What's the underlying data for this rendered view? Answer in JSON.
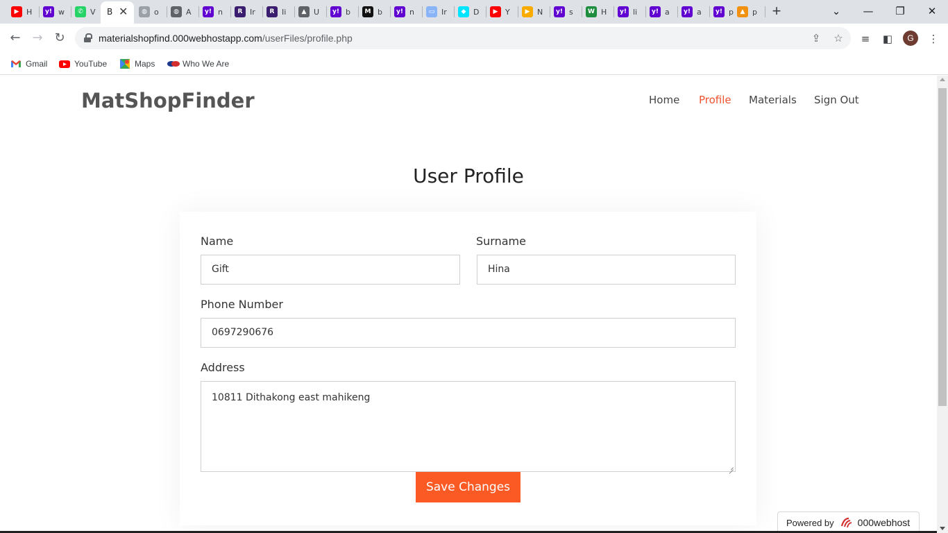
{
  "browser": {
    "tabs": [
      {
        "icon": "youtube-icon",
        "title": "H",
        "color": "#ff0000"
      },
      {
        "icon": "yahoo-icon",
        "title": "w",
        "color": "#6001d2"
      },
      {
        "icon": "whatsapp-icon",
        "title": "V",
        "color": "#25d366"
      },
      {
        "icon": "globe-icon",
        "title": "o",
        "color": "#9aa0a6"
      },
      {
        "icon": "globe-icon",
        "title": "A",
        "color": "#5f6368"
      },
      {
        "icon": "yahoo-icon",
        "title": "n",
        "color": "#6001d2"
      },
      {
        "icon": "r-icon",
        "title": "Ir",
        "color": "#3a1d6e"
      },
      {
        "icon": "r-icon",
        "title": "Ii",
        "color": "#3a1d6e"
      },
      {
        "icon": "cap-icon",
        "title": "U",
        "color": "#5f6368"
      },
      {
        "icon": "yahoo-icon",
        "title": "b",
        "color": "#6001d2"
      },
      {
        "icon": "m-icon",
        "title": "b",
        "color": "#111111"
      },
      {
        "icon": "yahoo-icon",
        "title": "n",
        "color": "#6001d2"
      },
      {
        "icon": "frame-icon",
        "title": "Ir",
        "color": "#8ab4f8"
      },
      {
        "icon": "cyan-icon",
        "title": "D",
        "color": "#00e5ff"
      },
      {
        "icon": "youtube-icon",
        "title": "Y",
        "color": "#ff0000"
      },
      {
        "icon": "play-icon",
        "title": "N",
        "color": "#f9ab00"
      },
      {
        "icon": "yahoo-icon",
        "title": "s",
        "color": "#6001d2"
      },
      {
        "icon": "w-icon",
        "title": "H",
        "color": "#1e8e3e"
      },
      {
        "icon": "yahoo-icon",
        "title": "li",
        "color": "#6001d2"
      },
      {
        "icon": "yahoo-icon",
        "title": "a",
        "color": "#6001d2"
      },
      {
        "icon": "yahoo-icon",
        "title": "a",
        "color": "#6001d2"
      },
      {
        "icon": "yahoo-icon",
        "title": "p",
        "color": "#6001d2"
      },
      {
        "icon": "pma-icon",
        "title": "p",
        "color": "#f29111"
      }
    ],
    "active_tab_title": "B",
    "url_host": "materialshopfind.000webhostapp.com",
    "url_path": "/userFiles/profile.php",
    "avatar_letter": "G",
    "bookmarks": [
      {
        "label": "Gmail",
        "icon": "gmail-icon"
      },
      {
        "label": "YouTube",
        "icon": "youtube-icon"
      },
      {
        "label": "Maps",
        "icon": "maps-icon"
      },
      {
        "label": "Who We Are",
        "icon": "who-we-are-icon"
      }
    ]
  },
  "site": {
    "brand": "MatShopFinder",
    "nav": [
      {
        "label": "Home",
        "active": false
      },
      {
        "label": "Profile",
        "active": true
      },
      {
        "label": "Materials",
        "active": false
      },
      {
        "label": "Sign Out",
        "active": false
      }
    ],
    "accent_color": "#fb5a24"
  },
  "profile": {
    "title": "User Profile",
    "name_label": "Name",
    "name_value": "Gift",
    "surname_label": "Surname",
    "surname_value": "Hina",
    "phone_label": "Phone Number",
    "phone_value": "0697290676",
    "address_label": "Address",
    "address_value": "10811 Dithakong east mahikeng",
    "save_label": "Save Changes"
  },
  "footer": {
    "powered_by": "Powered by",
    "host_brand": "000webhost"
  }
}
